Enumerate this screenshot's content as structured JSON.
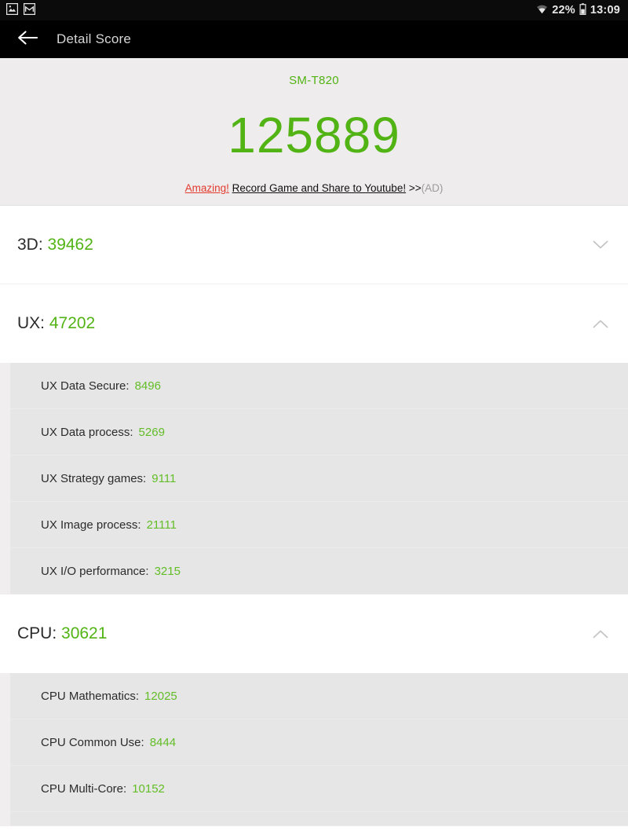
{
  "statusbar": {
    "icons": [
      {
        "name": "image-icon",
        "glyph": "🖼"
      },
      {
        "name": "gmail-icon",
        "glyph": "M"
      }
    ],
    "wifi_icon": "wifi-icon",
    "battery_percent": "22%",
    "battery_icon": "battery-icon",
    "time": "13:09"
  },
  "appbar": {
    "back_icon": "back-arrow-icon",
    "title": "Detail Score"
  },
  "summary": {
    "device_model": "SM-T820",
    "total_score": "125889",
    "ad": {
      "highlight": "Amazing!",
      "text": "Record Game and Share to Youtube!",
      "arrows": ">>",
      "tag": "(AD)"
    }
  },
  "colors": {
    "score_green": "#52b314",
    "sub_value_green": "#62bd26",
    "ad_red": "#e23b2e",
    "appbar_bg": "#000000",
    "summary_bg": "#eeecec",
    "sub_row_bg": "#e6e6e6"
  },
  "sections": [
    {
      "key": "3d",
      "label": "3D: ",
      "value": "39462",
      "expanded": false,
      "chevron": "chevron-down-icon",
      "items": []
    },
    {
      "key": "ux",
      "label": "UX: ",
      "value": "47202",
      "expanded": true,
      "chevron": "chevron-up-icon",
      "items": [
        {
          "label": "UX Data Secure:",
          "value": "8496"
        },
        {
          "label": "UX Data process:",
          "value": "5269"
        },
        {
          "label": "UX Strategy games:",
          "value": "9111"
        },
        {
          "label": "UX Image process:",
          "value": "21111"
        },
        {
          "label": "UX I/O performance:",
          "value": "3215"
        }
      ]
    },
    {
      "key": "cpu",
      "label": "CPU: ",
      "value": "30621",
      "expanded": true,
      "chevron": "chevron-up-icon",
      "items": [
        {
          "label": "CPU Mathematics:",
          "value": "12025"
        },
        {
          "label": "CPU Common Use:",
          "value": "8444"
        },
        {
          "label": "CPU Multi-Core:",
          "value": "10152"
        }
      ]
    }
  ]
}
